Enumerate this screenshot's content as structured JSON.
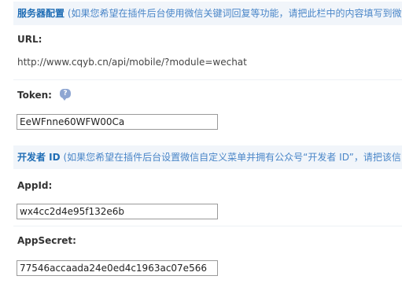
{
  "server_section": {
    "title": "服务器配置",
    "description": "(如果您希望在插件后台使用微信关键词回复等功能，请把此栏中的内容填写到微"
  },
  "url": {
    "label": "URL:",
    "value": "http://www.cqyb.cn/api/mobile/?module=wechat"
  },
  "token": {
    "label": "Token:",
    "help_icon": "comment-help-icon",
    "help_glyph": "?",
    "value": "EeWFnne60WFW00Ca"
  },
  "developer_section": {
    "title": "开发者 ID",
    "description": "(如果您希望在插件后台设置微信自定义菜单并拥有公众号“开发者 ID”，请把该信"
  },
  "app_id": {
    "label": "AppId:",
    "value": "wx4cc2d4e95f132e6b"
  },
  "app_secret": {
    "label": "AppSecret:",
    "value": "77546accaada24e0ed4c1963ac07e566"
  },
  "colors": {
    "section_background": "#f1f5fa",
    "section_title": "#1f6db5",
    "section_description": "#4a86c8",
    "field_border": "#9a9a9a"
  }
}
